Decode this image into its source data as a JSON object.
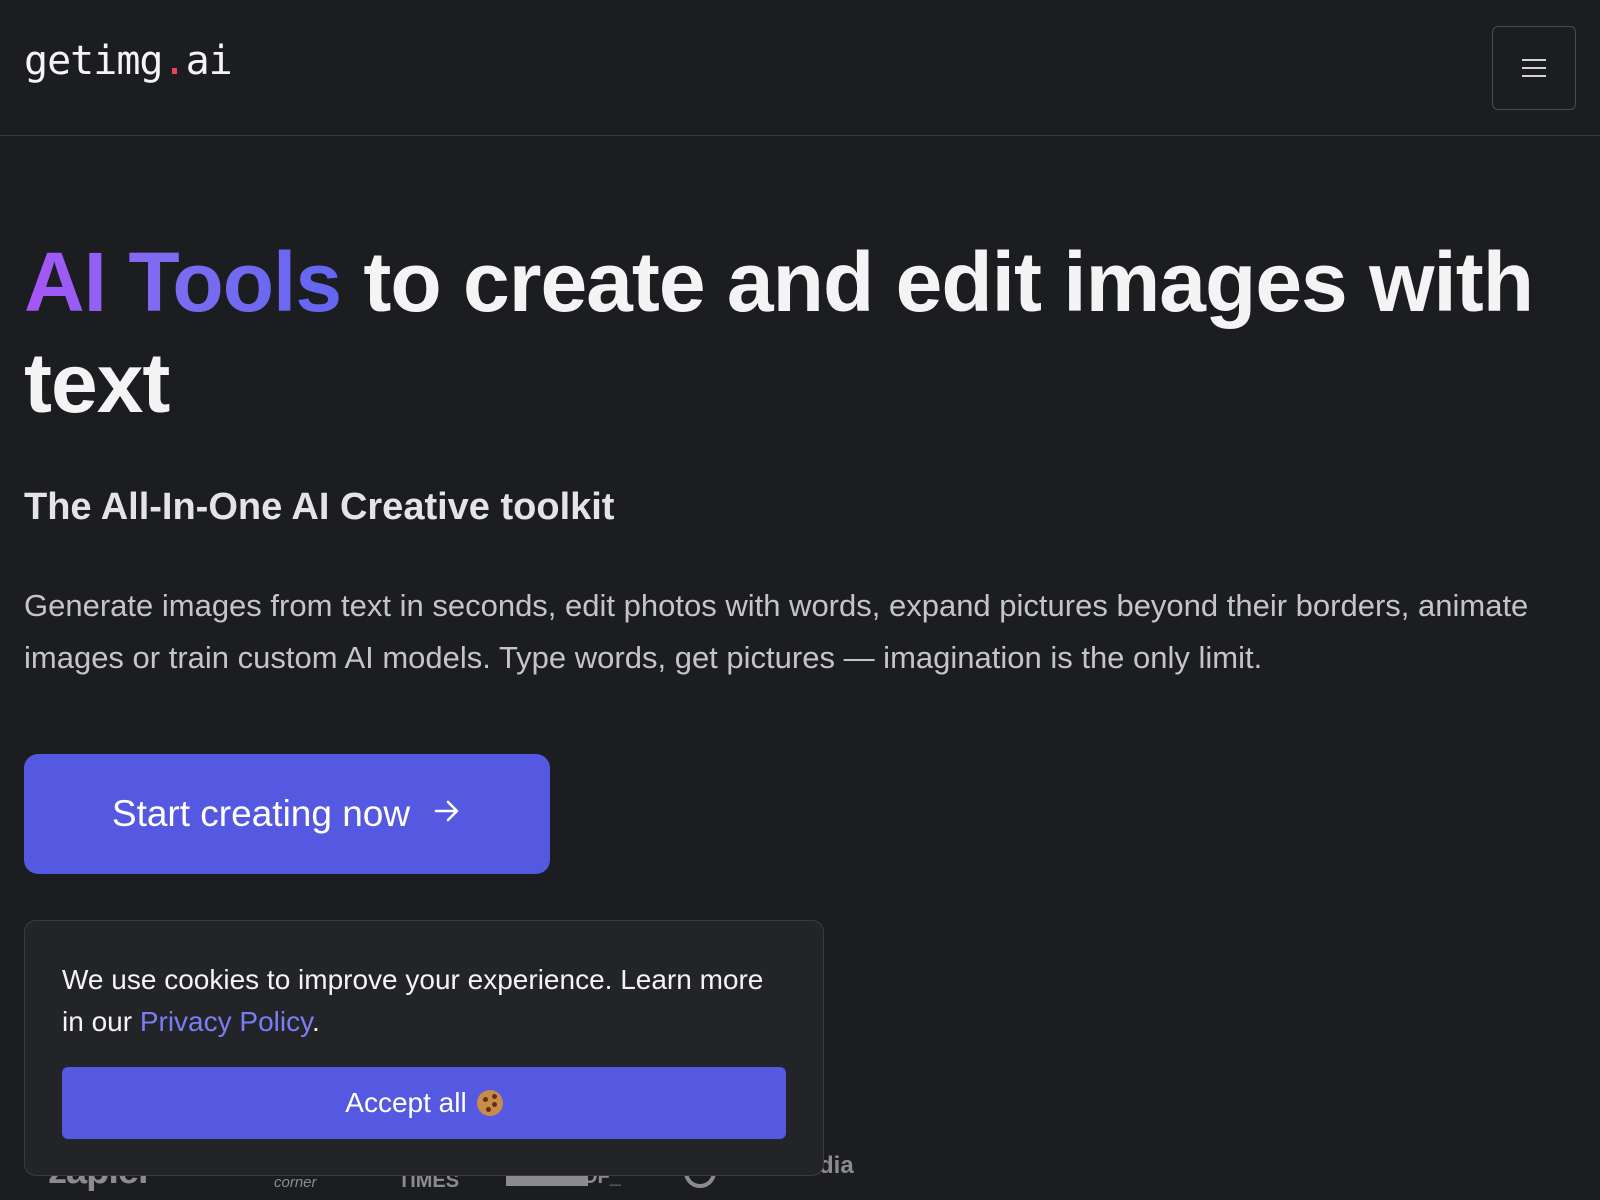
{
  "header": {
    "logo_main": "getimg",
    "logo_dot": ".",
    "logo_suffix": "ai",
    "menu_icon": "hamburger-menu-icon"
  },
  "hero": {
    "title_highlight": "AI Tools",
    "title_rest": " to create and edit images with text",
    "tagline": "The All-In-One AI Creative toolkit",
    "description": "Generate images from text in seconds, edit photos with words, expand pictures beyond their borders, animate images or train custom AI models. Type words, get pictures — imagination is the only limit.",
    "cta_label": "Start creating now",
    "cta_icon": "arrow-right-icon"
  },
  "partners": {
    "zapier": "zapier",
    "corner": "corner",
    "times": "TIMES",
    "of": "OF_",
    "dia": "dia"
  },
  "cookie_banner": {
    "text_before": "We use cookies to improve your experience. Learn more in our ",
    "link_label": "Privacy Policy",
    "text_after": ".",
    "accept_label": "Accept all",
    "accept_icon": "cookie-icon"
  },
  "colors": {
    "background": "#1c1d20",
    "accent": "#5558e0",
    "gradient_start": "#a855f7",
    "gradient_end": "#6366f1",
    "logo_dot": "#f43f5e",
    "link": "#7b7df5"
  }
}
